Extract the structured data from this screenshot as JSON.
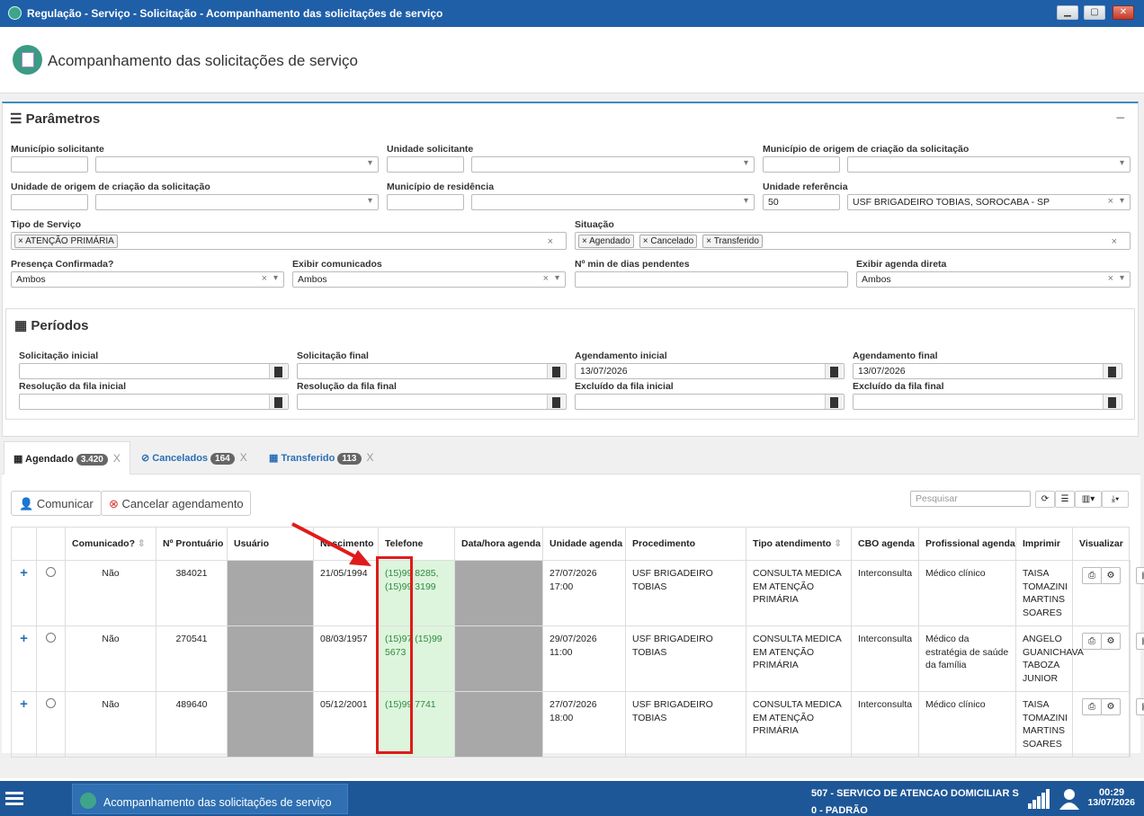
{
  "window": {
    "title": "Regulação - Serviço - Solicitação - Acompanhamento das solicitações de serviço",
    "min": "▁",
    "max": "▢",
    "close": "✕"
  },
  "page": {
    "title": "Acompanhamento das solicitações de serviço"
  },
  "params": {
    "title": "Parâmetros",
    "labels": {
      "municipio_solicitante": "Município solicitante",
      "unidade_solicitante": "Unidade solicitante",
      "municipio_origem": "Município de origem de criação da solicitação",
      "unidade_origem": "Unidade de origem de criação da solicitação",
      "municipio_residencia": "Município de residência",
      "unidade_referencia": "Unidade referência",
      "tipo_servico": "Tipo de Serviço",
      "situacao": "Situação",
      "presenca": "Presença Confirmada?",
      "exibir_comunicados": "Exibir comunicados",
      "min_dias": "Nº min de dias pendentes",
      "exibir_agenda": "Exibir agenda direta"
    },
    "values": {
      "unidade_ref_code": "50",
      "unidade_ref_name": "USF BRIGADEIRO TOBIAS, SOROCABA - SP",
      "tipo_servico_tag": "ATENÇÃO PRIMÁRIA",
      "situacao_tags": [
        "Agendado",
        "Cancelado",
        "Transferido"
      ],
      "presenca": "Ambos",
      "exibir_comunicados": "Ambos",
      "exibir_agenda": "Ambos"
    }
  },
  "periodos": {
    "title": "Períodos",
    "labels": {
      "sol_ini": "Solicitação inicial",
      "sol_fim": "Solicitação final",
      "ag_ini": "Agendamento inicial",
      "ag_fim": "Agendamento final",
      "res_ini": "Resolução da fila inicial",
      "res_fim": "Resolução da fila final",
      "exc_ini": "Excluído da fila inicial",
      "exc_fim": "Excluído da fila final"
    },
    "values": {
      "ag_ini": "13/07/2026",
      "ag_fim": "13/07/2026"
    }
  },
  "tabs": [
    {
      "label": "Agendado",
      "count": "3.420"
    },
    {
      "label": "Cancelados",
      "count": "164"
    },
    {
      "label": "Transferido",
      "count": "113"
    }
  ],
  "toolbar": {
    "comunicar": "Comunicar",
    "cancelar": "Cancelar agendamento",
    "search_placeholder": "Pesquisar"
  },
  "table": {
    "headers": [
      "Comunicado?",
      "Nº Prontuário",
      "Usuário",
      "Nascimento",
      "Telefone",
      "Data/hora agenda",
      "Unidade agenda",
      "Procedimento",
      "Tipo atendimento",
      "CBO agenda",
      "Profissional agenda",
      "Imprimir",
      "Visualizar"
    ],
    "rows": [
      {
        "comunicado": "Não",
        "prontuario": "384021",
        "nascimento": "21/05/1994",
        "telefone": "(15)99 8285, (15)99 3199",
        "data_agenda": "27/07/2026 17:00",
        "unidade": "USF BRIGADEIRO TOBIAS",
        "procedimento": "CONSULTA MEDICA EM ATENÇÃO PRIMÁRIA",
        "tipo": "Interconsulta",
        "cbo": "Médico clínico",
        "profissional": "TAISA TOMAZINI MARTINS SOARES"
      },
      {
        "comunicado": "Não",
        "prontuario": "270541",
        "nascimento": "08/03/1957",
        "telefone": "(15)97 (15)99 5673",
        "data_agenda": "29/07/2026 11:00",
        "unidade": "USF BRIGADEIRO TOBIAS",
        "procedimento": "CONSULTA MEDICA EM ATENÇÃO PRIMÁRIA",
        "tipo": "Interconsulta",
        "cbo": "Médico da estratégia de saúde da família",
        "profissional": "ANGELO GUANICHAVA TABOZA JUNIOR"
      },
      {
        "comunicado": "Não",
        "prontuario": "489640",
        "nascimento": "05/12/2001",
        "telefone": "(15)99 7741",
        "data_agenda": "27/07/2026 18:00",
        "unidade": "USF BRIGADEIRO TOBIAS",
        "procedimento": "CONSULTA MEDICA EM ATENÇÃO PRIMÁRIA",
        "tipo": "Interconsulta",
        "cbo": "Médico clínico",
        "profissional": "TAISA TOMAZINI MARTINS SOARES"
      }
    ]
  },
  "taskbar": {
    "task": "Acompanhamento das solicitações de serviço",
    "unit_line1": "507 - SERVICO DE ATENCAO DOMICILIAR S",
    "unit_line2": "0 - PADRÃO",
    "time": "00:29",
    "date": "13/07/2026"
  }
}
